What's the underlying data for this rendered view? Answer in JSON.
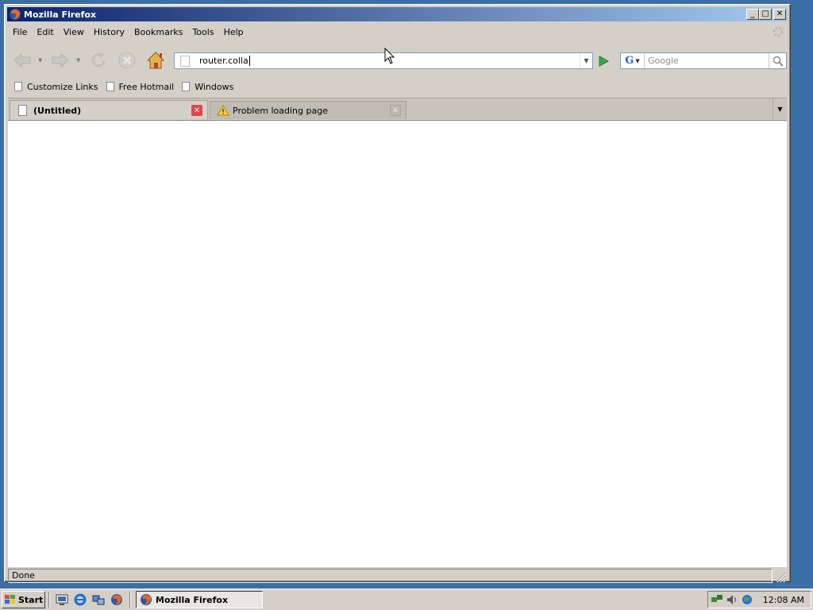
{
  "window": {
    "title": "Mozilla Firefox",
    "controls": {
      "minimize": "_",
      "maximize": "□",
      "close": "✕"
    }
  },
  "menu": {
    "items": [
      {
        "label": "File"
      },
      {
        "label": "Edit"
      },
      {
        "label": "View"
      },
      {
        "label": "History"
      },
      {
        "label": "Bookmarks"
      },
      {
        "label": "Tools"
      },
      {
        "label": "Help"
      }
    ]
  },
  "navbar": {
    "back_icon": "back-arrow-icon",
    "forward_icon": "forward-arrow-icon",
    "reload_icon": "reload-icon",
    "stop_icon": "stop-icon",
    "home_icon": "home-icon",
    "url_value": "router.colla",
    "go_icon": "go-arrow-icon",
    "search_engine": "G",
    "search_placeholder": "Google",
    "search_icon": "magnifier-icon"
  },
  "bookmarks": {
    "items": [
      {
        "label": "Customize Links"
      },
      {
        "label": "Free Hotmail"
      },
      {
        "label": "Windows"
      }
    ]
  },
  "tabs": [
    {
      "label": "(Untitled)",
      "active": true
    },
    {
      "label": "Problem loading page",
      "active": false
    }
  ],
  "status": {
    "text": "Done"
  },
  "taskbar": {
    "start_label": "Start",
    "task_label": "Mozilla Firefox",
    "clock": "12:08 AM"
  },
  "colors": {
    "titlebar_start": "#0a246a",
    "titlebar_end": "#a6caf0",
    "desktop": "#3a6ea5",
    "chrome": "#d4d0c8",
    "tab_close_active": "#e0444c"
  }
}
